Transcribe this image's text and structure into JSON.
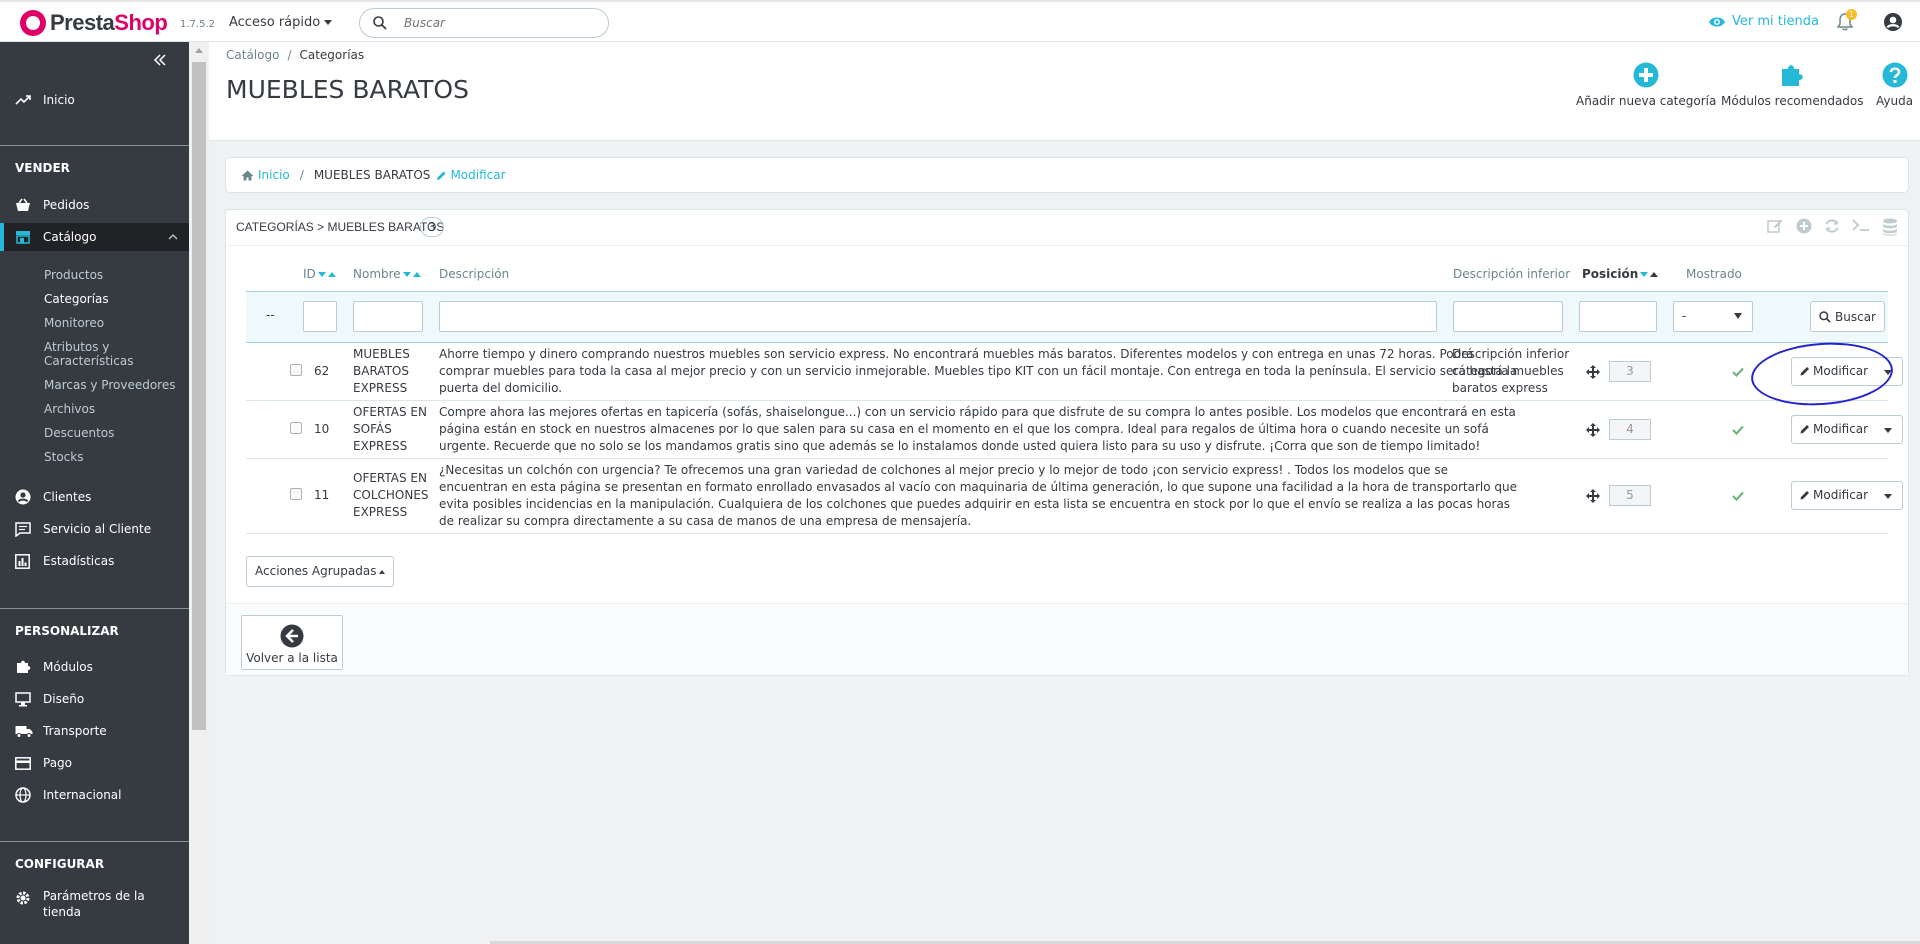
{
  "app": {
    "logo_prefix": "Presta",
    "logo_suffix": "Shop",
    "version": "1.7.5.2",
    "quick_access": "Acceso rápido",
    "search_placeholder": "Buscar",
    "view_store": "Ver mi tienda",
    "notifications_count": "1"
  },
  "sidebar": {
    "inicio": "Inicio",
    "vender": "VENDER",
    "pedidos": "Pedidos",
    "catalogo": "Catálogo",
    "catalogo_sub": [
      "Productos",
      "Categorías",
      "Monitoreo",
      "Atributos y",
      "Características",
      "Marcas y Proveedores",
      "Archivos",
      "Descuentos",
      "Stocks"
    ],
    "clientes": "Clientes",
    "servicio": "Servicio al Cliente",
    "estadisticas": "Estadísticas",
    "personalizar": "PERSONALIZAR",
    "modulos": "Módulos",
    "diseno": "Diseño",
    "transporte": "Transporte",
    "pago": "Pago",
    "internacional": "Internacional",
    "configurar": "CONFIGURAR",
    "parametros_1": "Parámetros de la",
    "parametros_2": "tienda"
  },
  "header": {
    "breadcrumb_parent": "Catálogo",
    "breadcrumb_sep": "/",
    "breadcrumb_current": "Categorías",
    "title": "MUEBLES BARATOS",
    "toolbar": {
      "add_category": "Añadir nueva categoría",
      "recommended_modules": "Módulos recomendados",
      "help": "Ayuda"
    }
  },
  "category_breadcrumb": {
    "home": "Inicio",
    "sep": "/",
    "current": "MUEBLES BARATOS",
    "edit": "Modificar"
  },
  "list": {
    "title": "Categorías > MUEBLES BARATOS",
    "count": "3",
    "columns": {
      "id": "ID",
      "name": "Nombre",
      "description": "Descripción",
      "additional_description": "Descripción inferior",
      "position": "Posición",
      "displayed": "Mostrado"
    },
    "filter": {
      "dash": "--",
      "displayed_value": "-",
      "search_button": "Buscar"
    },
    "rows": [
      {
        "id": "62",
        "name": [
          "MUEBLES",
          "BARATOS",
          "EXPRESS"
        ],
        "description": [
          "Ahorre tiempo y dinero comprando nuestros muebles son servicio express. No encontrará muebles más baratos. Diferentes modelos y con entrega en unas 72 horas. Podrá",
          "comprar muebles para toda la casa al mejor precio y con un servicio inmejorable. Muebles tipo KIT con un fácil montaje. Con entrega en toda la península. El servicio será hasta la",
          "puerta del domicilio."
        ],
        "additional_description": [
          "Descripción inferior",
          "categoría muebles",
          "baratos express"
        ],
        "position": "3",
        "action": "Modificar"
      },
      {
        "id": "10",
        "name": [
          "OFERTAS EN",
          "SOFÁS",
          "EXPRESS"
        ],
        "description": [
          "Compre ahora las mejores ofertas en tapicería (sofás, shaiselongue...) con un servicio rápido para que disfrute de su compra lo antes posible. Los modelos que encontrará en esta",
          "página están en stock en nuestros almacenes por lo que salen para su casa en el momento en el que los compra. Ideal para regalos de última hora o cuando necesite un sofá",
          "urgente. Recuerde que no solo se los mandamos gratis sino que además se lo instalamos donde usted quiera listo para su uso y disfrute. ¡Corra que son de tiempo limitado!"
        ],
        "additional_description": [],
        "position": "4",
        "action": "Modificar"
      },
      {
        "id": "11",
        "name": [
          "OFERTAS EN",
          "COLCHONES",
          "EXPRESS"
        ],
        "description": [
          "¿Necesitas un colchón con urgencia? Te ofrecemos una gran variedad de colchones al mejor precio y lo mejor de todo ¡con servicio express! . Todos los modelos que se",
          "encuentran en esta página se presentan en formato enrollado envasados al vacío con maquinaria de última generación, lo que supone una facilidad a la hora de transportarlo que",
          "evita posibles incidencias en la manipulación. Cualquiera de los colchones que puedes adquirir en esta lista se encuentra en stock por lo que el envío se realiza a las pocas horas",
          "de realizar su compra directamente a su casa de manos de una empresa de mensajería."
        ],
        "additional_description": [],
        "position": "5",
        "action": "Modificar"
      }
    ],
    "bulk_actions": "Acciones Agrupadas",
    "back_to_list": "Volver a la lista"
  },
  "colors": {
    "accent": "#25b9d7",
    "sidebar_bg": "#363a41",
    "brand": "#df0067",
    "success": "#70b580",
    "annotation": "#2424c8"
  }
}
